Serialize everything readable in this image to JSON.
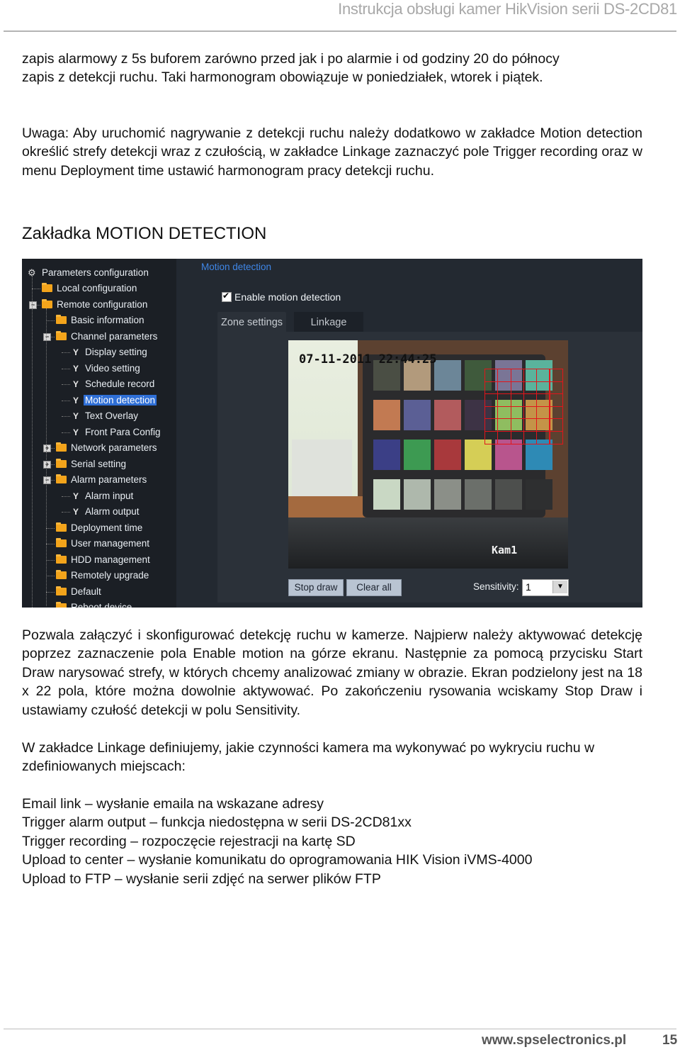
{
  "header": {
    "title": "Instrukcja obsługi kamer HikVision serii DS-2CD81"
  },
  "intro": {
    "lines": [
      "zapis alarmowy z 5s buforem zarówno przed jak i po alarmie i od godziny 20 do północy",
      "zapis z detekcji ruchu. Taki harmonogram obowiązuje w poniedziałek, wtorek i piątek."
    ]
  },
  "note": {
    "text": "Uwaga: Aby uruchomić nagrywanie z detekcji ruchu należy dodatkowo w zakładce Motion detection określić strefy detekcji wraz z czułością, w zakładce Linkage zaznaczyć pole Trigger recording oraz w menu Deployment time ustawić harmonogram pracy detekcji ruchu."
  },
  "section": {
    "heading": "Zakładka MOTION DETECTION"
  },
  "screenshot": {
    "tree": {
      "root": "Parameters configuration",
      "items": [
        {
          "label": "Local configuration",
          "icon": "folder-icon",
          "level": 1
        },
        {
          "label": "Remote configuration",
          "icon": "folder-icon",
          "level": 1,
          "expander": "-"
        },
        {
          "label": "Basic information",
          "icon": "folder-icon",
          "level": 2
        },
        {
          "label": "Channel parameters",
          "icon": "folder-icon",
          "level": 2,
          "expander": "-"
        },
        {
          "label": "Display setting",
          "icon": "wrench-icon",
          "level": 3
        },
        {
          "label": "Video setting",
          "icon": "wrench-icon",
          "level": 3
        },
        {
          "label": "Schedule record",
          "icon": "wrench-icon",
          "level": 3
        },
        {
          "label": "Motion detection",
          "icon": "wrench-icon",
          "level": 3,
          "selected": true
        },
        {
          "label": "Text Overlay",
          "icon": "wrench-icon",
          "level": 3
        },
        {
          "label": "Front Para Config",
          "icon": "wrench-icon",
          "level": 3
        },
        {
          "label": "Network parameters",
          "icon": "folder-icon",
          "level": 2,
          "expander": "+"
        },
        {
          "label": "Serial setting",
          "icon": "folder-icon",
          "level": 2,
          "expander": "+"
        },
        {
          "label": "Alarm parameters",
          "icon": "folder-icon",
          "level": 2,
          "expander": "-"
        },
        {
          "label": "Alarm input",
          "icon": "wrench-icon",
          "level": 3
        },
        {
          "label": "Alarm output",
          "icon": "wrench-icon",
          "level": 3
        },
        {
          "label": "Deployment time",
          "icon": "folder-icon",
          "level": 2
        },
        {
          "label": "User management",
          "icon": "folder-icon",
          "level": 2
        },
        {
          "label": "HDD management",
          "icon": "folder-icon",
          "level": 2
        },
        {
          "label": "Remotely upgrade",
          "icon": "folder-icon",
          "level": 2
        },
        {
          "label": "Default",
          "icon": "folder-icon",
          "level": 2
        },
        {
          "label": "Reboot device",
          "icon": "folder-icon",
          "level": 2
        }
      ]
    },
    "panel_title": "Motion detection",
    "enable_label": "Enable motion detection",
    "enable_checked": true,
    "tabs": [
      {
        "label": "Zone settings",
        "active": true
      },
      {
        "label": "Linkage",
        "active": false
      }
    ],
    "video": {
      "timestamp": "07-11-2011 22:44:25",
      "camera_name": "Kam1"
    },
    "buttons": {
      "stop_draw": "Stop draw",
      "clear_all": "Clear all"
    },
    "sensitivity": {
      "label": "Sensitivity:",
      "value": "1"
    },
    "colors": {
      "selection": "#2f6fd6",
      "title_link": "#3f86e6",
      "grid": "#e2151b"
    }
  },
  "description": {
    "paragraph1": "Pozwala załączyć i skonfigurować detekcję ruchu w kamerze. Najpierw należy aktywować detekcję poprzez zaznaczenie pola Enable motion na górze ekranu. Następnie za pomocą przycisku Start Draw narysować strefy, w których chcemy analizować zmiany w obrazie. Ekran podzielony jest na 18 x 22 pola, które można dowolnie aktywować. Po zakończeniu rysowania wciskamy Stop Draw i ustawiamy czułość detekcji w polu Sensitivity.",
    "paragraph2": "W zakładce Linkage definiujemy, jakie czynności kamera ma wykonywać po wykryciu ruchu w zdefiniowanych miejscach:"
  },
  "linkage_list": [
    "Email link – wysłanie emaila na wskazane adresy",
    "Trigger alarm output – funkcja niedostępna w serii DS-2CD81xx",
    "Trigger recording – rozpoczęcie rejestracji na kartę SD",
    "Upload to center – wysłanie komunikatu do oprogramowania HIK Vision iVMS-4000",
    "Upload to FTP – wysłanie serii zdjęć na serwer plików FTP"
  ],
  "footer": {
    "url": "www.spselectronics.pl",
    "page": "15"
  }
}
